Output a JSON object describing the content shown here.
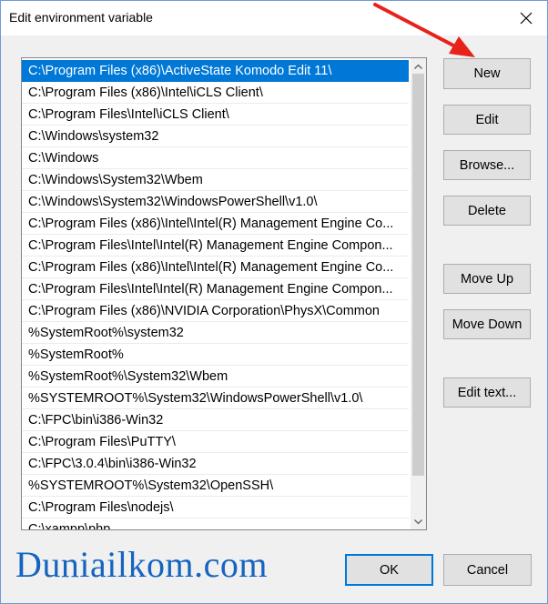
{
  "window": {
    "title": "Edit environment variable"
  },
  "paths": [
    "C:\\Program Files (x86)\\ActiveState Komodo Edit 11\\",
    "C:\\Program Files (x86)\\Intel\\iCLS Client\\",
    "C:\\Program Files\\Intel\\iCLS Client\\",
    "C:\\Windows\\system32",
    "C:\\Windows",
    "C:\\Windows\\System32\\Wbem",
    "C:\\Windows\\System32\\WindowsPowerShell\\v1.0\\",
    "C:\\Program Files (x86)\\Intel\\Intel(R) Management Engine Co...",
    "C:\\Program Files\\Intel\\Intel(R) Management Engine Compon...",
    "C:\\Program Files (x86)\\Intel\\Intel(R) Management Engine Co...",
    "C:\\Program Files\\Intel\\Intel(R) Management Engine Compon...",
    "C:\\Program Files (x86)\\NVIDIA Corporation\\PhysX\\Common",
    "%SystemRoot%\\system32",
    "%SystemRoot%",
    "%SystemRoot%\\System32\\Wbem",
    "%SYSTEMROOT%\\System32\\WindowsPowerShell\\v1.0\\",
    "C:\\FPC\\bin\\i386-Win32",
    "C:\\Program Files\\PuTTY\\",
    "C:\\FPC\\3.0.4\\bin\\i386-Win32",
    "%SYSTEMROOT%\\System32\\OpenSSH\\",
    "C:\\Program Files\\nodejs\\",
    "C:\\xampp\\php"
  ],
  "buttons": {
    "new": "New",
    "edit": "Edit",
    "browse": "Browse...",
    "delete": "Delete",
    "move_up": "Move Up",
    "move_down": "Move Down",
    "edit_text": "Edit text...",
    "ok": "OK",
    "cancel": "Cancel"
  },
  "watermark": {
    "text": "Duniailkom.com"
  },
  "colors": {
    "selection": "#0078d7",
    "annotation_arrow": "#e8221b",
    "watermark": "#1565c0"
  },
  "icons": {
    "close": "close-icon",
    "scroll_up": "chevron-up-icon",
    "scroll_down": "chevron-down-icon"
  }
}
